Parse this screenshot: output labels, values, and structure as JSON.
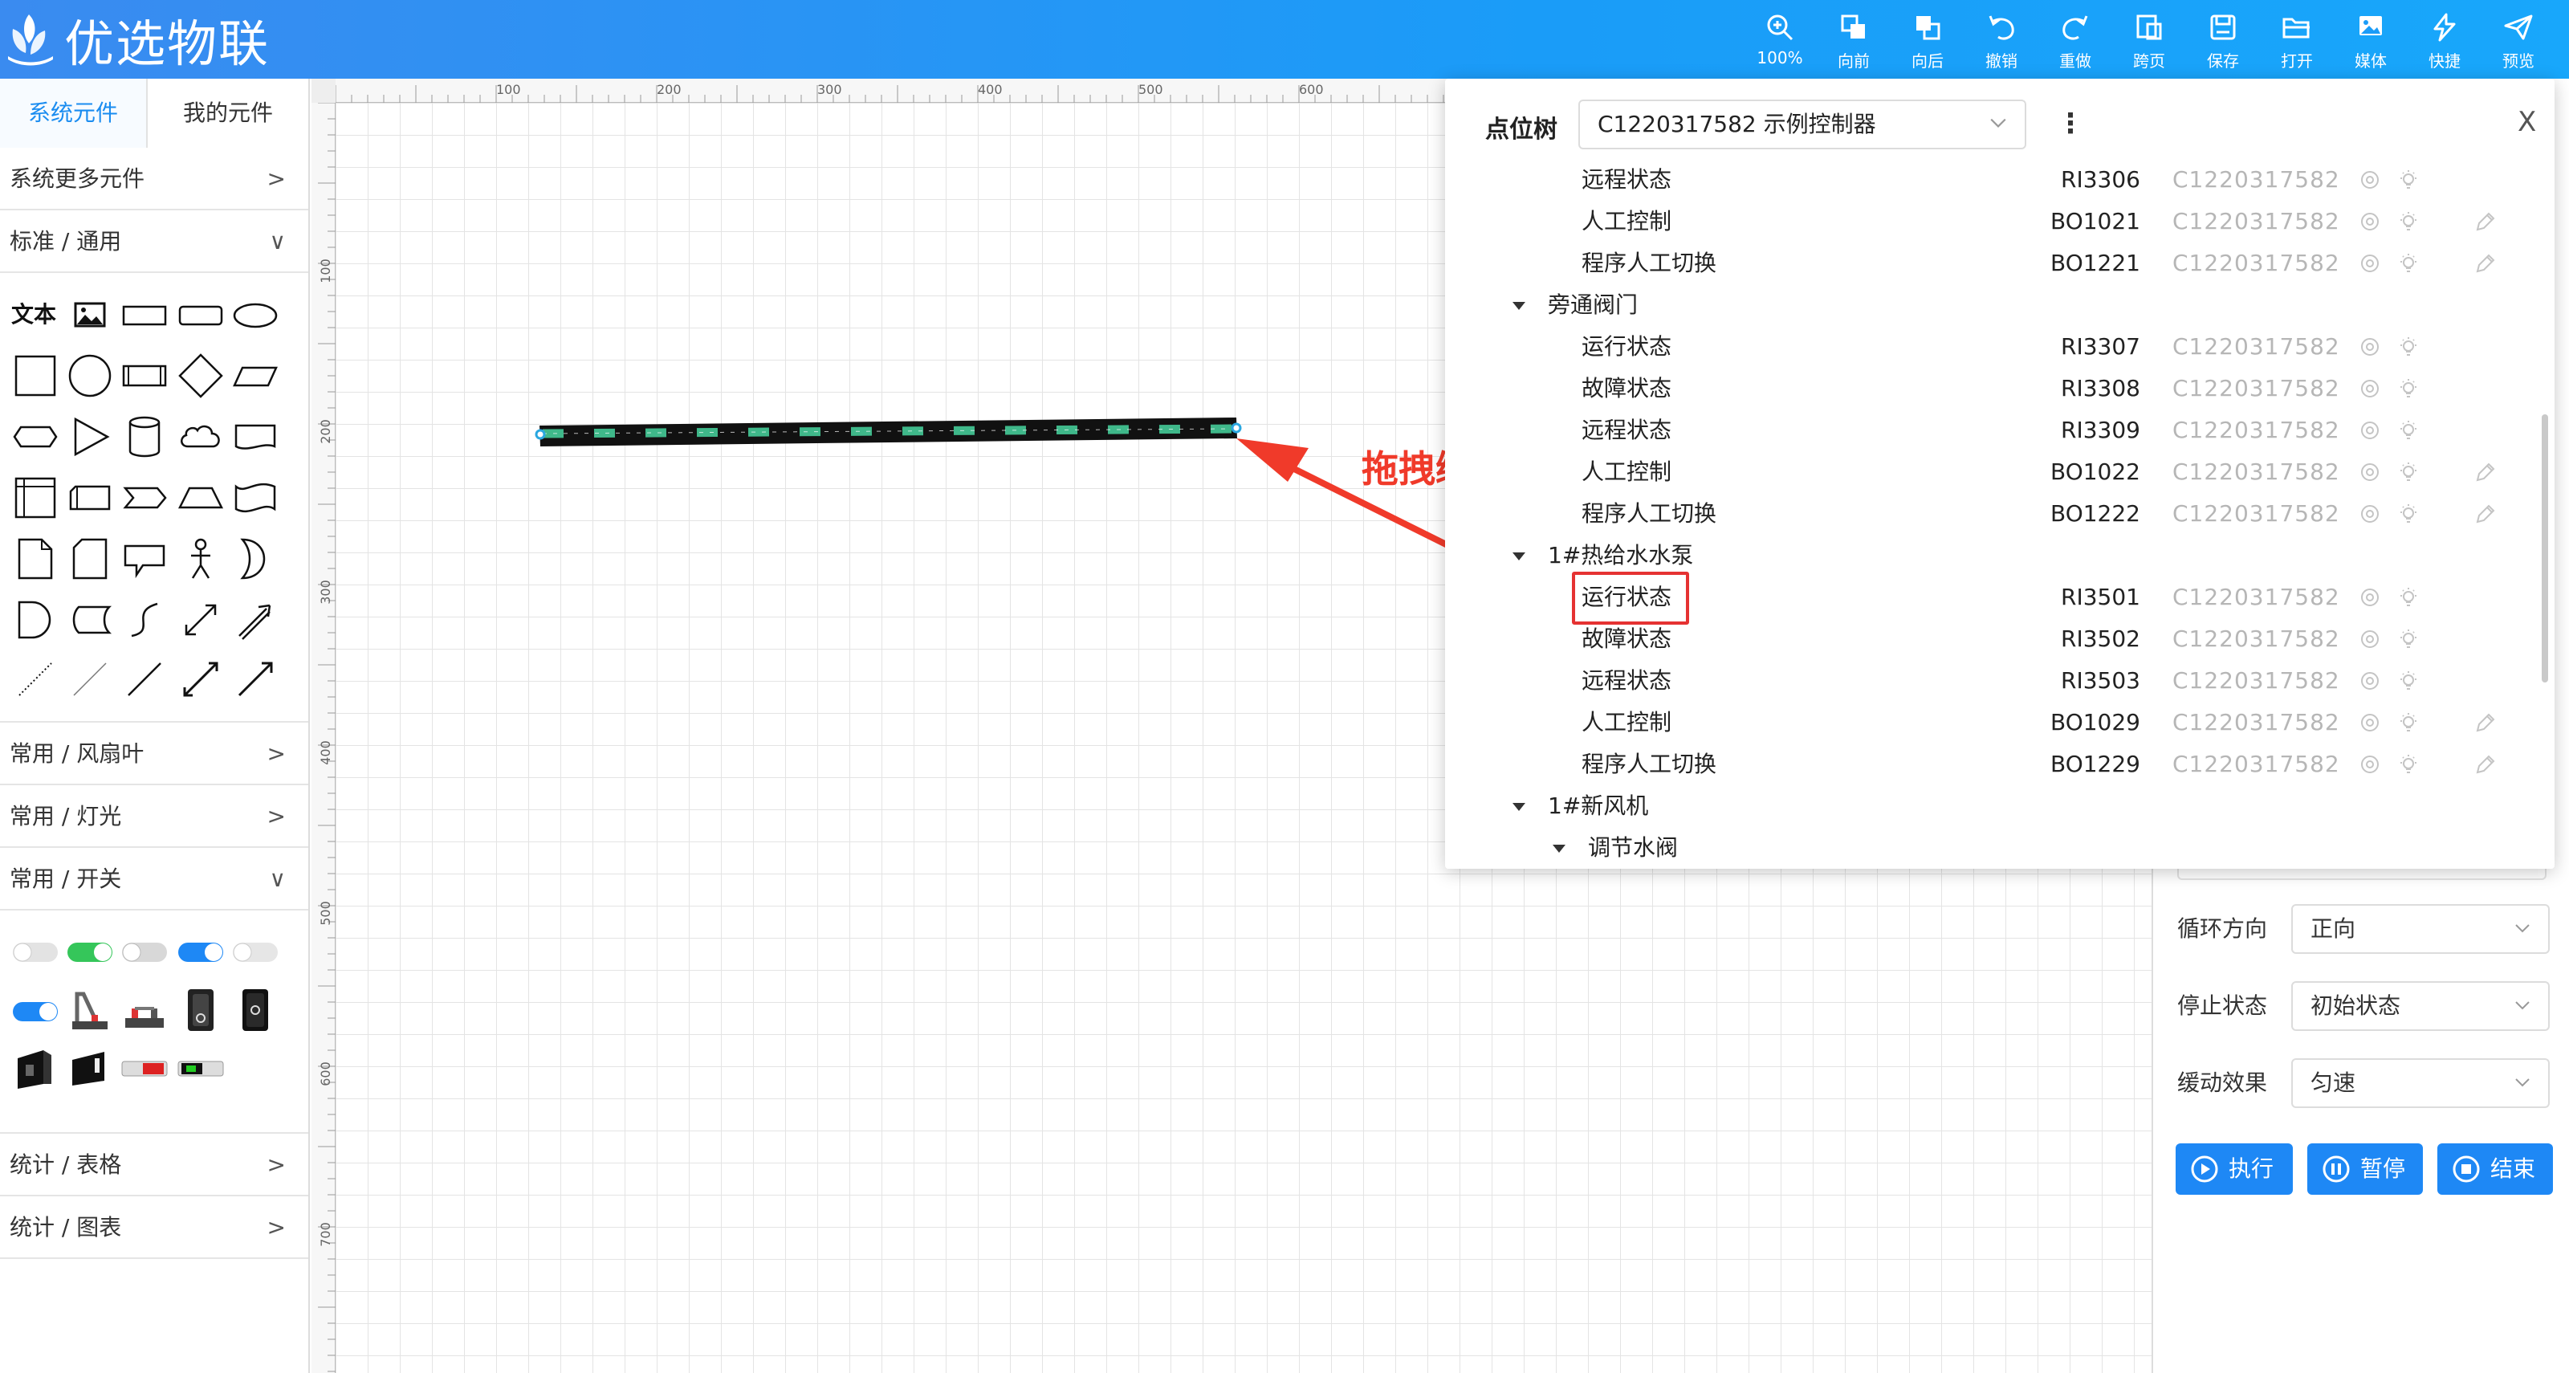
{
  "app": {
    "title": "优选物联"
  },
  "toolbar": [
    {
      "label": "100%",
      "icon": "zoom-in-icon"
    },
    {
      "label": "向前",
      "icon": "bring-forward-icon"
    },
    {
      "label": "向后",
      "icon": "send-backward-icon"
    },
    {
      "label": "撤销",
      "icon": "undo-icon"
    },
    {
      "label": "重做",
      "icon": "redo-icon"
    },
    {
      "label": "跨页",
      "icon": "cross-page-icon"
    },
    {
      "label": "保存",
      "icon": "save-icon"
    },
    {
      "label": "打开",
      "icon": "folder-open-icon"
    },
    {
      "label": "媒体",
      "icon": "media-icon"
    },
    {
      "label": "快捷",
      "icon": "lightning-icon"
    },
    {
      "label": "预览",
      "icon": "send-icon"
    }
  ],
  "left": {
    "tabs": [
      "系统元件",
      "我的元件"
    ],
    "sections": {
      "more": "系统更多元件",
      "standard": "标准 / 通用",
      "fan": "常用 / 风扇叶",
      "light": "常用 / 灯光",
      "switch": "常用 / 开关",
      "table": "统计 / 表格",
      "chart": "统计 / 图表"
    },
    "text_shape": "文本"
  },
  "ruler": {
    "top": [
      "100",
      "200",
      "300",
      "400",
      "500",
      "600"
    ],
    "left": [
      "100",
      "200",
      "300",
      "400",
      "500",
      "600",
      "700"
    ]
  },
  "annotation": "拖拽绑点",
  "point_tree": {
    "title": "点位树",
    "controller": "C1220317582 示例控制器",
    "close": "X",
    "rows": [
      {
        "name": "远程状态",
        "code": "RI3306",
        "device": "C1220317582",
        "editable": false,
        "level": 2
      },
      {
        "name": "人工控制",
        "code": "BO1021",
        "device": "C1220317582",
        "editable": true,
        "level": 2
      },
      {
        "name": "程序人工切换",
        "code": "BO1221",
        "device": "C1220317582",
        "editable": true,
        "level": 2
      },
      {
        "name": "旁通阀门",
        "code": "",
        "device": "",
        "editable": false,
        "level": 1
      },
      {
        "name": "运行状态",
        "code": "RI3307",
        "device": "C1220317582",
        "editable": false,
        "level": 2
      },
      {
        "name": "故障状态",
        "code": "RI3308",
        "device": "C1220317582",
        "editable": false,
        "level": 2
      },
      {
        "name": "远程状态",
        "code": "RI3309",
        "device": "C1220317582",
        "editable": false,
        "level": 2
      },
      {
        "name": "人工控制",
        "code": "BO1022",
        "device": "C1220317582",
        "editable": true,
        "level": 2
      },
      {
        "name": "程序人工切换",
        "code": "BO1222",
        "device": "C1220317582",
        "editable": true,
        "level": 2
      },
      {
        "name": "1#热给水水泵",
        "code": "",
        "device": "",
        "editable": false,
        "level": 1
      },
      {
        "name": "运行状态",
        "code": "RI3501",
        "device": "C1220317582",
        "editable": false,
        "level": 2
      },
      {
        "name": "故障状态",
        "code": "RI3502",
        "device": "C1220317582",
        "editable": false,
        "level": 2
      },
      {
        "name": "远程状态",
        "code": "RI3503",
        "device": "C1220317582",
        "editable": false,
        "level": 2
      },
      {
        "name": "人工控制",
        "code": "BO1029",
        "device": "C1220317582",
        "editable": true,
        "level": 2
      },
      {
        "name": "程序人工切换",
        "code": "BO1229",
        "device": "C1220317582",
        "editable": true,
        "level": 2
      },
      {
        "name": "1#新风机",
        "code": "",
        "device": "",
        "editable": false,
        "level": 1
      },
      {
        "name": "调节水阀",
        "code": "",
        "device": "",
        "editable": false,
        "level": 3
      }
    ]
  },
  "props": {
    "loop_label": "循环方向",
    "loop_value": "正向",
    "stop_label": "停止状态",
    "stop_value": "初始状态",
    "ease_label": "缓动效果",
    "ease_value": "匀速",
    "run": "执行",
    "pause": "暂停",
    "end": "结束"
  },
  "colors": {
    "accent": "#1e88f5",
    "highlight": "#e53232",
    "pipe_flow": "#3fb88a"
  }
}
